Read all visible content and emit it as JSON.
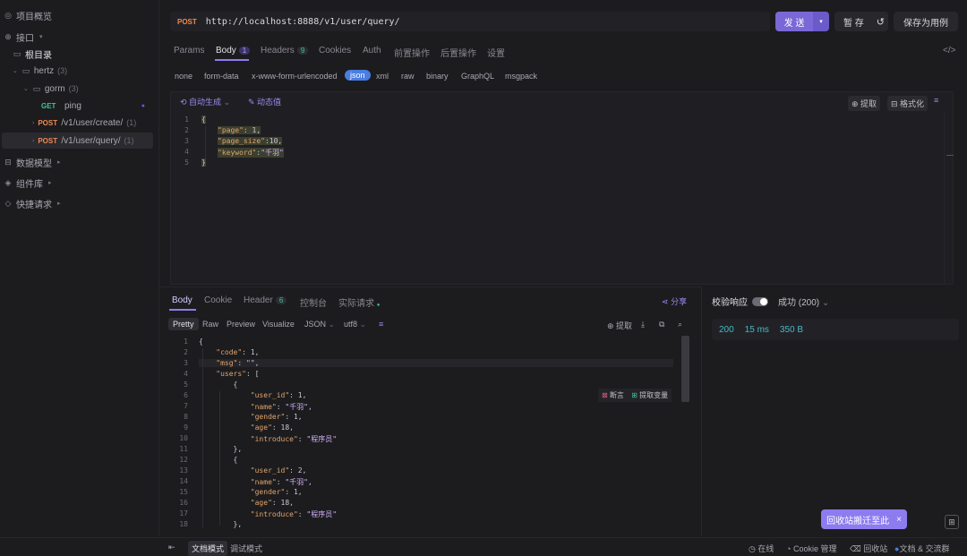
{
  "sidebar": {
    "overview": "项目概览",
    "interfaces": "接口",
    "root": "根目录",
    "folder_hertz": "hertz",
    "folder_hertz_count": "(3)",
    "folder_gorm": "gorm",
    "folder_gorm_count": "(3)",
    "items": [
      {
        "method": "GET",
        "name": "ping",
        "count": ""
      },
      {
        "method": "POST",
        "name": "/v1/user/create/",
        "count": "(1)"
      },
      {
        "method": "POST",
        "name": "/v1/user/query/",
        "count": "(1)"
      }
    ],
    "data_model": "数据模型",
    "components": "组件库",
    "quick_request": "快捷请求"
  },
  "request": {
    "method": "POST",
    "url": "http://localhost:8888/v1/user/query/",
    "send": "发 送",
    "save_temp": "暂 存",
    "save_case": "保存为用例",
    "tabs": [
      {
        "label": "Params",
        "badge": ""
      },
      {
        "label": "Body",
        "badge": "1"
      },
      {
        "label": "Headers",
        "badge": "9"
      },
      {
        "label": "Cookies",
        "badge": ""
      },
      {
        "label": "Auth",
        "badge": ""
      },
      {
        "label": "前置操作",
        "badge": ""
      },
      {
        "label": "后置操作",
        "badge": ""
      },
      {
        "label": "设置",
        "badge": ""
      }
    ],
    "body_types": [
      "none",
      "form-data",
      "x-www-form-urlencoded",
      "json",
      "xml",
      "raw",
      "binary",
      "GraphQL",
      "msgpack"
    ],
    "active_body_type": "json",
    "auto_generate": "自动生成",
    "dynamic_value": "动态值",
    "extract": "提取",
    "format": "格式化",
    "code_lines": [
      "1",
      "2",
      "3",
      "4",
      "5"
    ],
    "code": {
      "open": "{",
      "page_key": "\"page\"",
      "page_val": ": 1,",
      "page_size_key": "\"page_size\"",
      "page_size_val": ":10,",
      "keyword_key": "\"keyword\"",
      "keyword_sep": ":",
      "keyword_val": "\"千羽\"",
      "close": "}"
    }
  },
  "response": {
    "tabs": [
      {
        "label": "Body",
        "badge": ""
      },
      {
        "label": "Cookie",
        "badge": ""
      },
      {
        "label": "Header",
        "badge": "6"
      },
      {
        "label": "控制台",
        "badge": ""
      },
      {
        "label": "实际请求",
        "badge": ""
      }
    ],
    "share": "分享",
    "views": [
      "Pretty",
      "Raw",
      "Preview",
      "Visualize"
    ],
    "format": "JSON",
    "encoding": "utf8",
    "extract": "提取",
    "breakpoint": "断言",
    "extract_var": "提取变量",
    "line_numbers": [
      "1",
      "2",
      "3",
      "4",
      "5",
      "6",
      "7",
      "8",
      "9",
      "10",
      "11",
      "12",
      "13",
      "14",
      "15",
      "16",
      "17",
      "18"
    ],
    "lines": [
      "{",
      "    \"code\": 1,",
      "    \"msg\": \"\",",
      "    \"users\": [",
      "        {",
      "            \"user_id\": 1,",
      "            \"name\": \"千羽\",",
      "            \"gender\": 1,",
      "            \"age\": 18,",
      "            \"introduce\": \"程序员\"",
      "        },",
      "        {",
      "            \"user_id\": 2,",
      "            \"name\": \"千羽\",",
      "            \"gender\": 1,",
      "            \"age\": 18,",
      "            \"introduce\": \"程序员\"",
      "        },"
    ],
    "validate_label": "校验响应",
    "result": "成功 (200)",
    "status_code": "200",
    "time": "15 ms",
    "size": "350 B"
  },
  "bottom": {
    "doc_mode": "文档模式",
    "debug_mode": "调试模式",
    "online": "在线",
    "cookie_mgr": "Cookie 管理",
    "recycle": "回收站",
    "docs": "文档 & 交流群",
    "toast": "回收站搬迁至此"
  },
  "colors": {
    "accent": "#8c7cf0",
    "post": "#f08a4f",
    "get": "#42c38f",
    "json_active": "#4a7de0"
  }
}
